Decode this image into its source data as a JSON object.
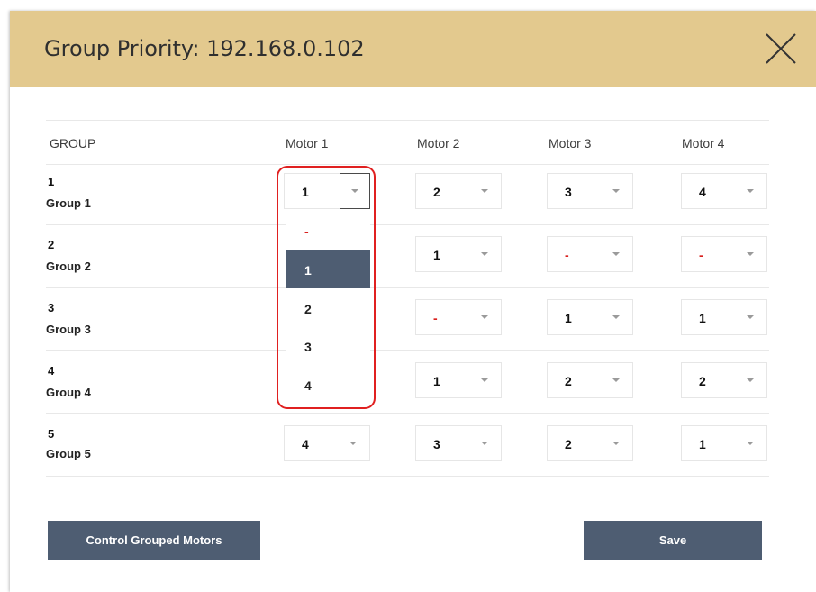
{
  "dialog": {
    "title": "Group Priority: 192.168.0.102",
    "close_icon": "close-icon"
  },
  "table": {
    "headers": [
      "GROUP",
      "Motor 1",
      "Motor 2",
      "Motor 3",
      "Motor 4"
    ],
    "rows": [
      {
        "num": "1",
        "name": "Group 1",
        "motors": [
          "1",
          "2",
          "3",
          "4"
        ]
      },
      {
        "num": "2",
        "name": "Group 2",
        "motors": [
          "",
          "1",
          "-",
          "-"
        ]
      },
      {
        "num": "3",
        "name": "Group 3",
        "motors": [
          "",
          "-",
          "1",
          "1"
        ]
      },
      {
        "num": "4",
        "name": "Group 4",
        "motors": [
          "",
          "1",
          "2",
          "2"
        ]
      },
      {
        "num": "5",
        "name": "Group 5",
        "motors": [
          "4",
          "3",
          "2",
          "1"
        ]
      }
    ]
  },
  "dropdown": {
    "options": [
      "-",
      "1",
      "2",
      "3",
      "4"
    ],
    "selected": "1"
  },
  "buttons": {
    "control_label": "Control Grouped Motors",
    "save_label": "Save"
  },
  "colors": {
    "header_bg": "#e3c98e",
    "button_bg": "#4e5d72",
    "dash_red": "#d9201e",
    "highlight_red": "#e02020"
  }
}
